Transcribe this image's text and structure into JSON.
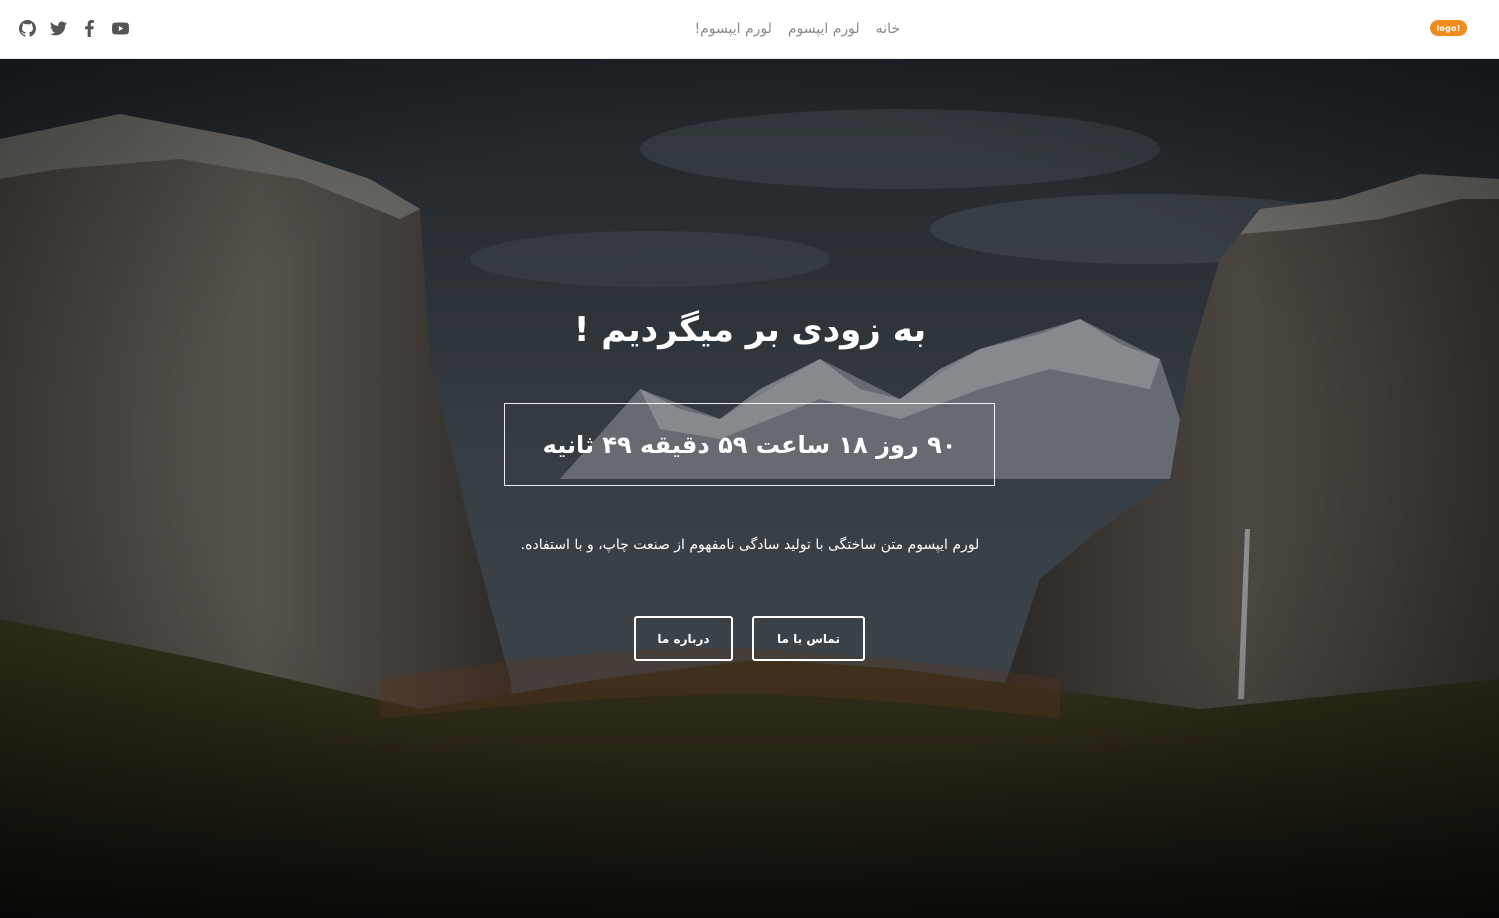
{
  "header": {
    "logo_text": "logo!",
    "nav": [
      "خانه",
      "لورم ایپسوم",
      "لورم ایپسوم!"
    ],
    "social_icons": [
      "github-icon",
      "twitter-icon",
      "facebook-icon",
      "youtube-icon"
    ],
    "accent_color": "#f28b1d"
  },
  "hero": {
    "title": "به زودی بر میگردیم !",
    "countdown": "۹۰ روز ۱۸ ساعت ۵۹ دقیقه ۴۹ ثانیه",
    "description": "لورم ایپسوم متن ساختگی با تولید سادگی نامفهوم از صنعت چاپ، و با استفاده.",
    "buttons": {
      "contact": "تماس با ما",
      "about": "درباره ما"
    }
  }
}
